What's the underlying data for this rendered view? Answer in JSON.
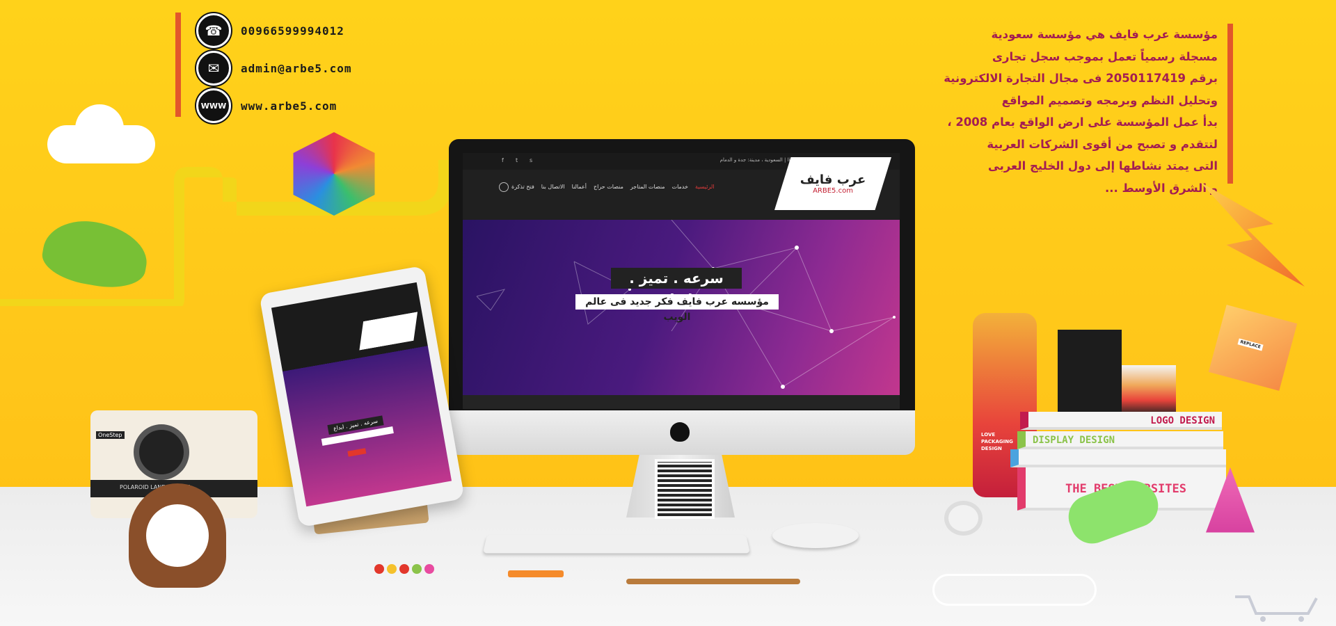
{
  "contact": {
    "phone": "00966599994012",
    "email": "admin@arbe5.com",
    "website": "www.arbe5.com",
    "icons": [
      "phone-icon",
      "mail-icon",
      "www-icon"
    ],
    "www_glyph": "WWW"
  },
  "about": {
    "lines": [
      "مؤسسة عرب فايف هي مؤسسة سعودية",
      "مسجلة رسمياً تعمل بموجب سجل تجارى",
      "برقم 2050117419 فى مجال التجارة الالكترونية",
      "وتحليل النظم وبرمجه وتصميم المواقع",
      "بدأ عمل المؤسسة على ارض الواقع بعام 2008 ،",
      "لتتقدم و تصبح من أقوى الشركات العربية",
      "التى يمتد نشاطها إلى دول الخليج العربى",
      "و الشرق الأوسط ..."
    ]
  },
  "website_preview": {
    "topbar_info": "السعودية ، مدينة: جدة و الدمام  |  live:arbe5com  |  0599994012",
    "logo_ar": "عرب فايف",
    "logo_en": "ARBE5.com",
    "nav": [
      "الرئيسية",
      "خدمات",
      "منصات المتاجر",
      "منصات حراج",
      "أعمالنا",
      "الاتصال بنا",
      "فتح تذكرة"
    ],
    "hero_title": "سرعه . تميز . ابداع",
    "hero_subtitle": "مؤسسه عرب فايف فكر جديد فى عالم الويب"
  },
  "tablet_preview": {
    "hero_title": "سرعه . تميز . ابداع"
  },
  "props": {
    "books": [
      "LOGO DESIGN",
      "DISPLAY DESIGN",
      "",
      "THE BEST WEBSITES"
    ],
    "bottle_label": "LOVE PACKAGING DESIGN",
    "note_label": "REPLACE",
    "camera_brand": "OneStep",
    "camera_label": "POLAROID LAND CAMERA"
  },
  "colors": {
    "background": "#ffc61a",
    "accent": "#e2572b",
    "about_text": "#a31d52",
    "hero_start": "#2a1363",
    "hero_end": "#c2378e"
  }
}
